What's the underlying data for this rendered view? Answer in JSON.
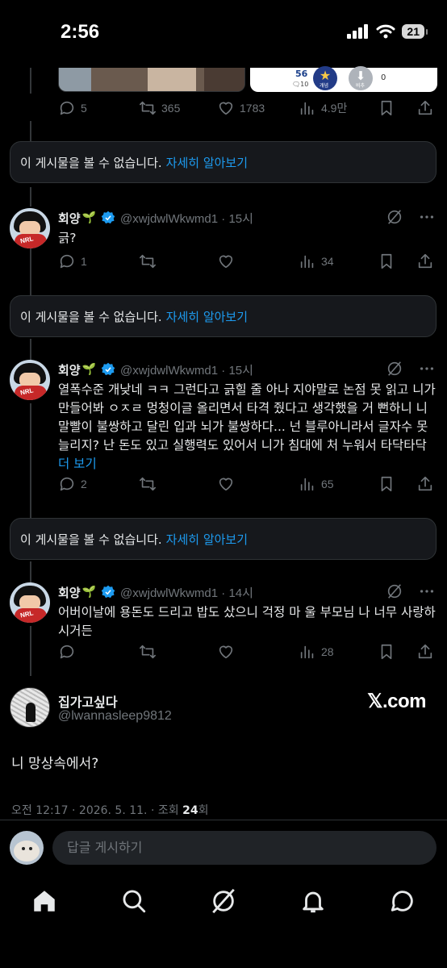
{
  "status_bar": {
    "time": "2:56",
    "battery": "21"
  },
  "top_card": {
    "right_panel": {
      "count": "56",
      "sub": "🗨10",
      "star_label": "개념",
      "down_label": "비추",
      "down_count": "0"
    }
  },
  "top_actions": {
    "replies": "5",
    "reposts": "365",
    "likes": "1783",
    "views": "4.9만"
  },
  "unavailable": {
    "text": "이 게시물을 볼 수 없습니다.",
    "link": "자세히 알아보기"
  },
  "tweets": [
    {
      "name": "회양",
      "emoji": "🌱",
      "handle": "@xwjdwlWkwmd1 · 15시",
      "body": "긁?",
      "more": "",
      "replies": "1",
      "reposts": "",
      "likes": "",
      "views": "34"
    },
    {
      "name": "회양",
      "emoji": "🌱",
      "handle": "@xwjdwlWkwmd1 · 15시",
      "body": "열폭수준 개낮네 ㅋㅋ 그런다고 긁힐 줄 아나 지야말로 논점 못 읽고 니가 만들어봐 ㅇㅈㄹ 멍청이글 올리면서 타격 줬다고 생각했을 거 뻔하니 니 말빨이 불쌍하고 달린 입과 뇌가 불쌍하다... 넌 블루아니라서 글자수 못 늘리지? 난 돈도 있고 실행력도 있어서 니가 침대에 처 누워서 타닥타닥",
      "more": "더 보기",
      "replies": "2",
      "reposts": "",
      "likes": "",
      "views": "65"
    },
    {
      "name": "회양",
      "emoji": "🌱",
      "handle": "@xwjdwlWkwmd1 · 14시",
      "body": "어버이날에 용돈도 드리고 밥도 샀으니 걱정 마 울 부모님 나 너무 사랑하시거든",
      "more": "",
      "replies": "",
      "reposts": "",
      "likes": "",
      "views": "28"
    }
  ],
  "main_tweet": {
    "name": "집가고싶다",
    "handle": "@lwannasleep9812",
    "watermark": "𝕏.com",
    "text": "니 망상속에서?",
    "meta_prefix": "오전 12:17 · 2026. 5. 11. · 조회 ",
    "views": "24",
    "views_suffix": "회"
  },
  "reply_bar": {
    "placeholder": "답글 게시하기"
  },
  "colors": {
    "accent": "#1d9bf0",
    "muted": "#71767b",
    "background": "#000000",
    "card": "#16181c"
  }
}
